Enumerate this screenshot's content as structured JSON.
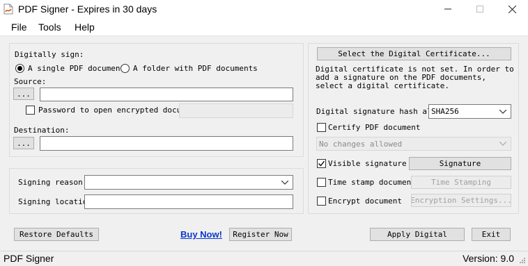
{
  "window": {
    "title": "PDF Signer - Expires in 30 days"
  },
  "menu": [
    "File",
    "Tools",
    "Help"
  ],
  "sign_group": {
    "heading": "Digitally sign:",
    "radio_single": "A single PDF document",
    "radio_folder": "A folder with PDF documents",
    "source_label": "Source:",
    "browse_label": "...",
    "source_value": "",
    "password_label": "Password to open encrypted documen",
    "password_value": "",
    "destination_label": "Destination:",
    "destination_value": ""
  },
  "reason_group": {
    "reason_label": "Signing reason:",
    "reason_value": "",
    "location_label": "Signing location",
    "location_value": ""
  },
  "certificate": {
    "select_button": "Select the Digital Certificate...",
    "info_text": "Digital certificate is not set. In order to add a signature on the PDF documents, select a digital certificate.",
    "hash_label": "Digital signature hash algo",
    "hash_value": "SHA256",
    "certify_label": "Certify PDF document",
    "certify_value": "No changes allowed",
    "visible_sig_label": "Visible signature box",
    "signature_button": "Signature",
    "timestamp_label": "Time stamp document",
    "timestamp_button": "Time Stamping",
    "encrypt_label": "Encrypt document",
    "encrypt_button": "Encryption Settings..."
  },
  "footer": {
    "restore_button": "Restore Defaults",
    "buy_link": "Buy Now!",
    "register_button": "Register Now",
    "apply_button": "Apply Digital",
    "exit_button": "Exit"
  },
  "status": {
    "left": "PDF Signer",
    "right": "Version: 9.0"
  },
  "state": {
    "radio_single_selected": true,
    "password_checked": false,
    "certify_checked": false,
    "visible_signature_checked": true,
    "timestamp_checked": false,
    "encrypt_checked": false
  },
  "colors": {
    "window_bg": "#f0f0f0",
    "link": "#0a38cc"
  }
}
